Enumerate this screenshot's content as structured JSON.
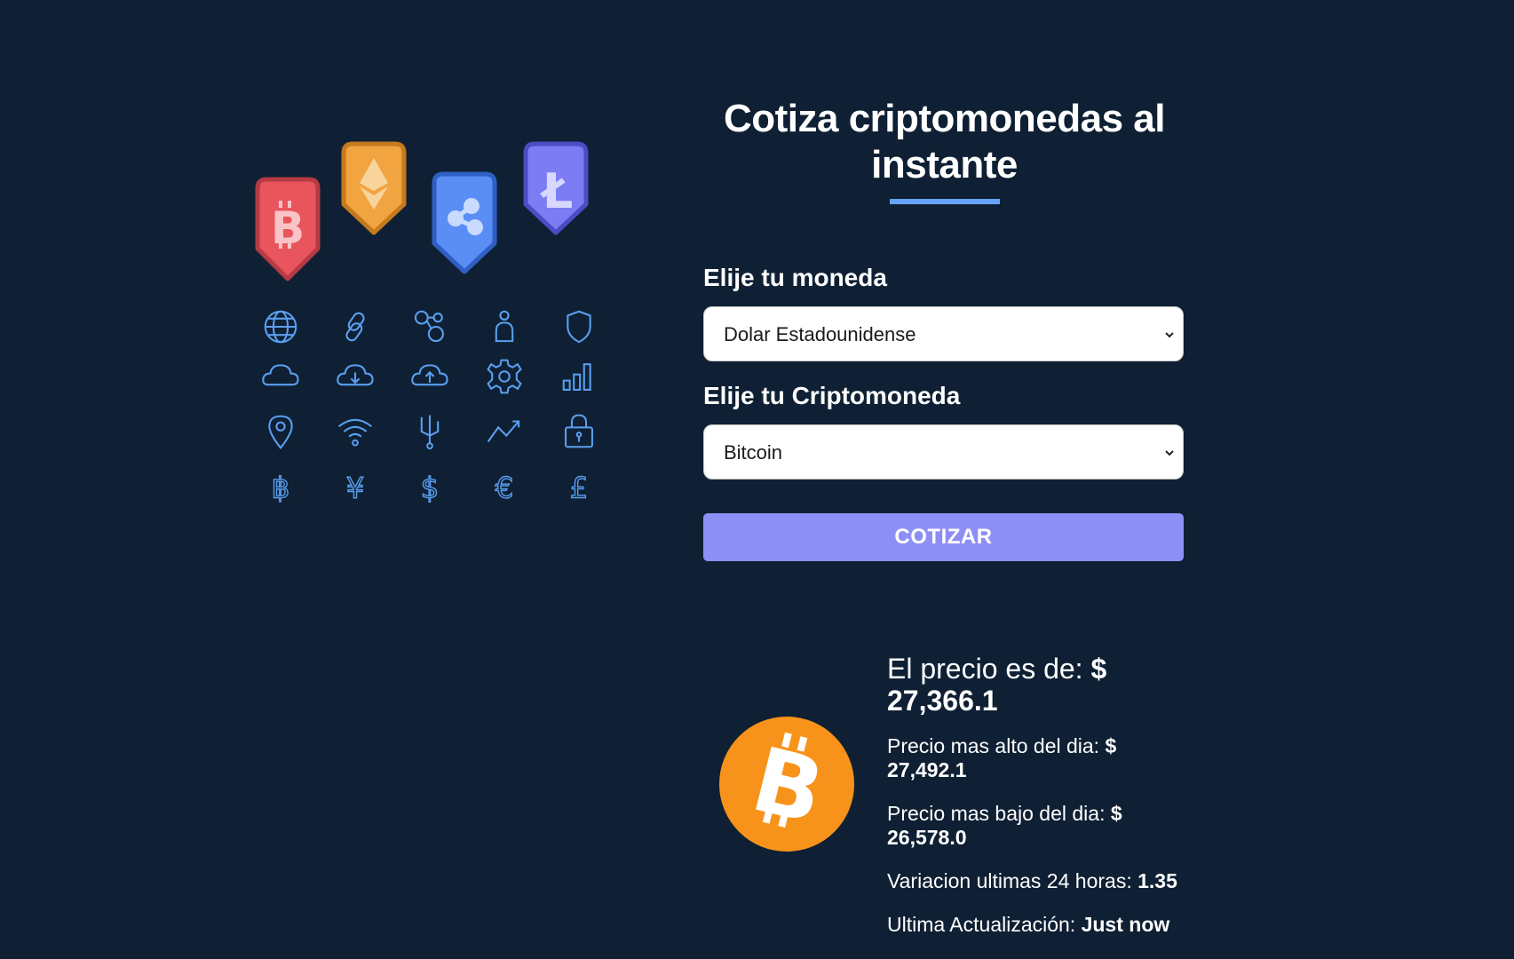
{
  "header": {
    "title_line1": "Cotiza criptomonedas al",
    "title_line2": "instante"
  },
  "form": {
    "currency_label": "Elije tu moneda",
    "currency_selected": "Dolar Estadounidense",
    "crypto_label": "Elije tu Criptomoneda",
    "crypto_selected": "Bitcoin",
    "submit_label": "COTIZAR"
  },
  "result": {
    "price_label": "El precio es de:",
    "price_value": "$ 27,366.1",
    "high_label": "Precio mas alto del dia:",
    "high_value": "$ 27,492.1",
    "low_label": "Precio mas bajo del dia:",
    "low_value": "$ 26,578.0",
    "change_label": "Variacion ultimas 24 horas:",
    "change_value": "1.35",
    "updated_label": "Ultima Actualización:",
    "updated_value": "Just now"
  },
  "illustration": {
    "badges": [
      "bitcoin-badge-icon",
      "ethereum-badge-icon",
      "ripple-badge-icon",
      "litecoin-badge-icon"
    ],
    "badge_colors": [
      "#e9555c",
      "#f2a441",
      "#5b8ef5",
      "#7c7cf5"
    ],
    "grid_icons": [
      "globe-icon",
      "chain-link-icon",
      "network-nodes-icon",
      "user-icon",
      "shield-icon",
      "cloud-icon",
      "cloud-download-icon",
      "cloud-upload-icon",
      "gear-icon",
      "bar-chart-icon",
      "map-pin-icon",
      "wifi-icon",
      "usb-icon",
      "trend-up-icon",
      "padlock-icon",
      "bitcoin-symbol-icon",
      "yen-symbol-icon",
      "dollar-symbol-icon",
      "euro-symbol-icon",
      "pound-symbol-icon"
    ],
    "icon_color": "#5a9ff0"
  },
  "colors": {
    "background": "#0f2034",
    "accent_underline": "#66a2fe",
    "button": "#8e8ff6",
    "bitcoin_orange": "#f7931a"
  }
}
